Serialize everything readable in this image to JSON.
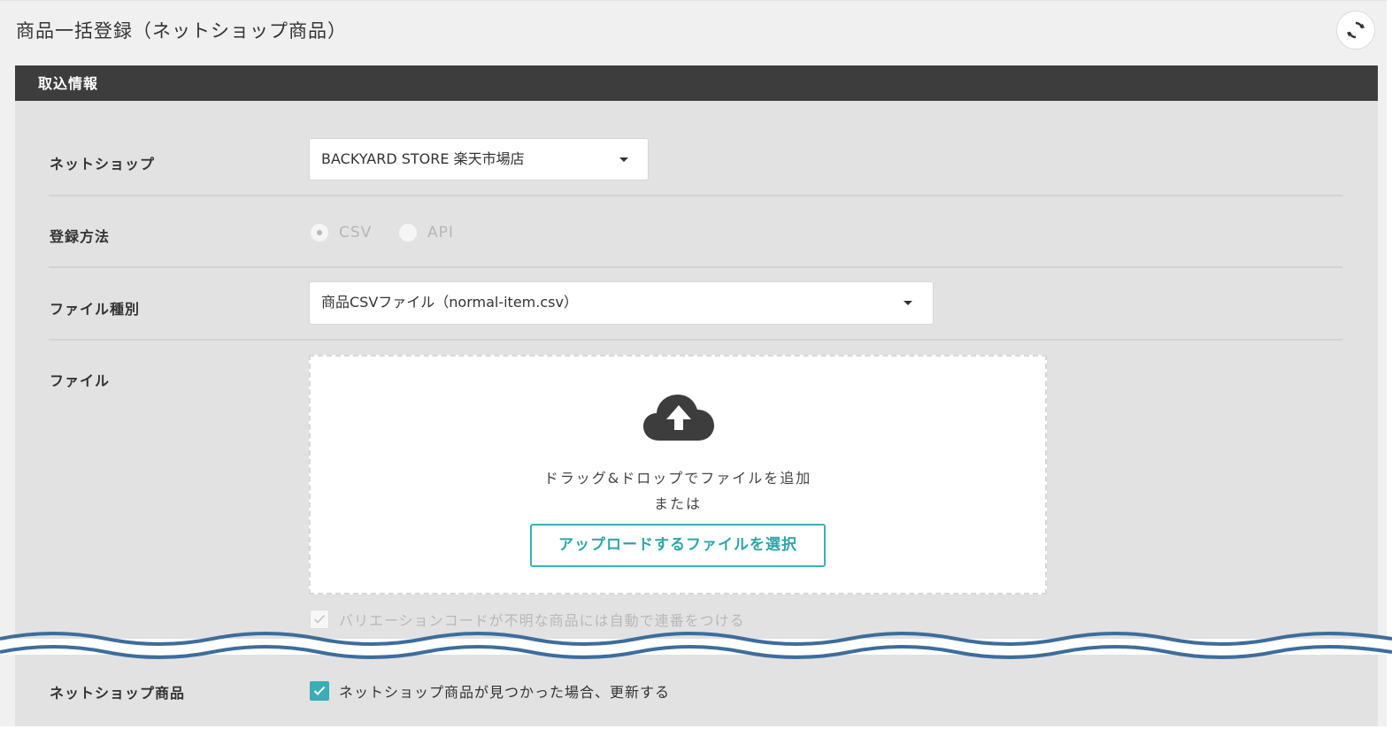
{
  "page": {
    "title": "商品一括登録（ネットショップ商品）"
  },
  "icons": {
    "refresh": "refresh-icon",
    "cloud_upload": "cloud-upload-icon",
    "caret": "caret-down-icon",
    "check": "check-icon"
  },
  "section": {
    "title": "取込情報"
  },
  "form": {
    "netshop": {
      "label": "ネットショップ",
      "value": "BACKYARD STORE 楽天市場店"
    },
    "method": {
      "label": "登録方法",
      "options": [
        {
          "label": "CSV",
          "selected": true
        },
        {
          "label": "API",
          "selected": false
        }
      ]
    },
    "file_type": {
      "label": "ファイル種別",
      "value": "商品CSVファイル（normal-item.csv）"
    },
    "file": {
      "label": "ファイル",
      "drop_text": "ドラッグ&ドロップでファイルを追加",
      "or_text": "または",
      "button_label": "アップロードするファイルを選択"
    },
    "variation_checkbox": {
      "label": "バリエーションコードが不明な商品には自動で連番をつける",
      "checked": true,
      "disabled": true
    },
    "netshop_items": {
      "label": "ネットショップ商品",
      "checkbox_label": "ネットショップ商品が見つかった場合、更新する",
      "checked": true
    }
  },
  "colors": {
    "header_bg": "#3d3d3d",
    "panel_bg": "#e2e2e2",
    "accent": "#38aeb5",
    "wave": "#3d6d9b"
  }
}
